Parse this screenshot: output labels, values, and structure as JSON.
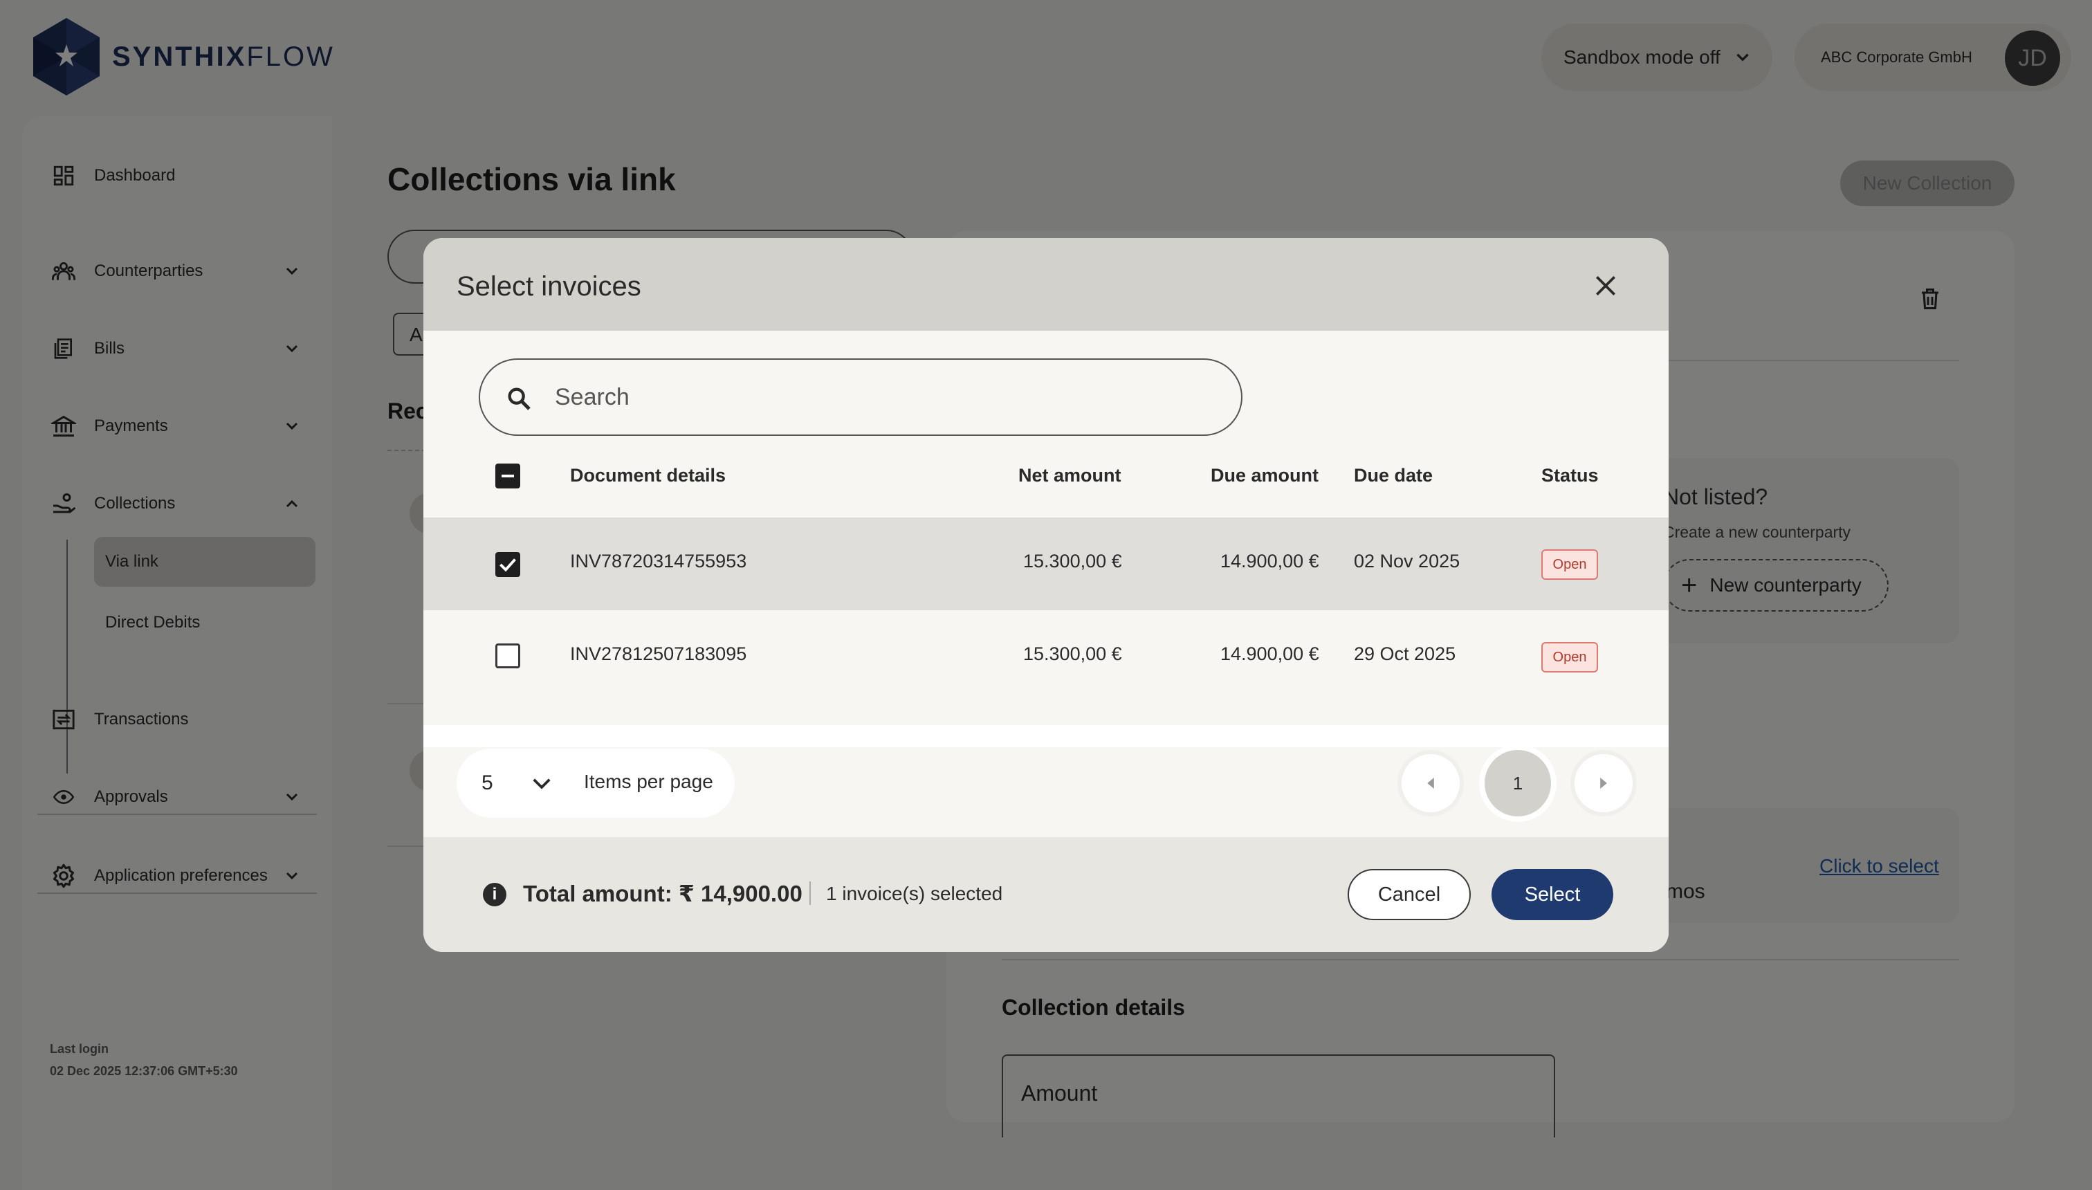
{
  "brand": {
    "name_bold": "SYNTHIX",
    "name_light": "FLOW"
  },
  "header": {
    "sandbox_label": "Sandbox mode off",
    "account_name": "ABC Corporate GmbH",
    "avatar_initials": "JD"
  },
  "sidebar": {
    "items": [
      {
        "label": "Dashboard",
        "icon": "dashboard-icon"
      },
      {
        "label": "Counterparties",
        "icon": "people-icon"
      },
      {
        "label": "Bills",
        "icon": "bill-icon"
      },
      {
        "label": "Payments",
        "icon": "bank-icon"
      },
      {
        "label": "Collections",
        "icon": "collections-icon"
      },
      {
        "label": "Transactions",
        "icon": "transactions-icon"
      },
      {
        "label": "Approvals",
        "icon": "eye-icon"
      },
      {
        "label": "Application preferences",
        "icon": "gear-icon"
      }
    ],
    "collections_sub": [
      {
        "label": "Via link",
        "active": true
      },
      {
        "label": "Direct Debits",
        "active": false
      }
    ],
    "last_login_label": "Last login",
    "last_login_value": "02 Dec 2025 12:37:06 GMT+5:30"
  },
  "page": {
    "title": "Collections via link",
    "new_collection_label": "New Collection",
    "filter_label": "A",
    "recent_label": "Rec",
    "not_listed_title": "Not listed?",
    "not_listed_sub": "Create a new counterparty",
    "new_counterparty_label": "New counterparty",
    "click_to_select": "Click to select",
    "mos_text": "mos",
    "collection_details_title": "Collection details",
    "amount_label": "Amount"
  },
  "modal": {
    "title": "Select invoices",
    "search_placeholder": "Search",
    "columns": {
      "document": "Document details",
      "net": "Net amount",
      "due_amount": "Due amount",
      "due_date": "Due date",
      "status": "Status"
    },
    "rows": [
      {
        "id": "INV78720314755953",
        "net": "15.300,00 €",
        "due_amount": "14.900,00 €",
        "due_date": "02 Nov 2025",
        "status": "Open",
        "checked": true
      },
      {
        "id": "INV27812507183095",
        "net": "15.300,00 €",
        "due_amount": "14.900,00 €",
        "due_date": "29 Oct 2025",
        "status": "Open",
        "checked": false
      }
    ],
    "per_page_value": "5",
    "per_page_label": "Items per page",
    "current_page": "1",
    "total_label": "Total amount: ₹ 14,900.00",
    "selected_count_label": "1 invoice(s) selected",
    "cancel_label": "Cancel",
    "select_label": "Select"
  },
  "colors": {
    "brand_navy": "#1d2e57",
    "primary_button": "#1f3a6e",
    "status_open_border": "#e07a70",
    "status_open_bg": "#fbe3df",
    "link": "#1e5aa8"
  }
}
